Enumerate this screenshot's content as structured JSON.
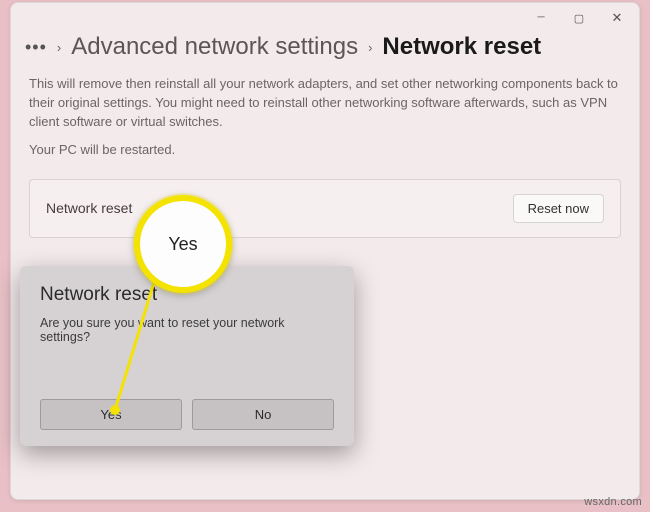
{
  "window": {
    "controls": {
      "min": "minimize",
      "max": "maximize",
      "close": "close"
    }
  },
  "breadcrumb": {
    "overflow": "•••",
    "parent": "Advanced network settings",
    "current": "Network reset"
  },
  "description": "This will remove then reinstall all your network adapters, and set other networking components back to their original settings. You might need to reinstall other networking software afterwards, such as VPN client software or virtual switches.",
  "restart_note": "Your PC will be restarted.",
  "card": {
    "label": "Network reset",
    "button": "Reset now"
  },
  "dialog": {
    "title": "Network reset",
    "message": "Are you sure you want to reset your network settings?",
    "yes": "Yes",
    "no": "No"
  },
  "callout": {
    "label": "Yes"
  },
  "watermark": "wsxdn.com",
  "colors": {
    "highlight": "#f4e200"
  }
}
